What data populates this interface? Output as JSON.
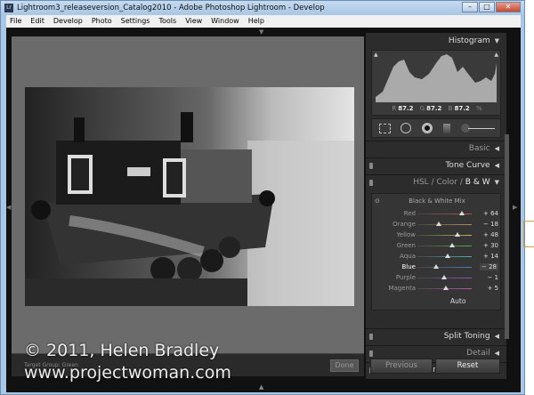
{
  "window": {
    "title": "Lightroom3_releaseversion_Catalog2010 - Adobe Photoshop Lightroom - Develop",
    "app_icon": "Lr",
    "controls": [
      "minimize",
      "maximize",
      "close"
    ]
  },
  "menu": [
    "File",
    "Edit",
    "Develop",
    "Photo",
    "Settings",
    "Tools",
    "View",
    "Window",
    "Help"
  ],
  "toolbar": {
    "target_group": "Target Group: Green",
    "done_label": "Done"
  },
  "watermark": {
    "line1": "© 2011, Helen Bradley",
    "line2": "www.projectwoman.com"
  },
  "panel": {
    "histogram": {
      "title": "Histogram",
      "r_label": "R",
      "r": "87.2",
      "g_label": "G",
      "g": "87.2",
      "b_label": "B",
      "b": "87.2",
      "unit": "%"
    },
    "sections": {
      "basic": "Basic",
      "tone_curve": "Tone Curve",
      "hsl": "HSL",
      "sep": "/",
      "color": "Color",
      "bw": "B & W",
      "split_toning": "Split Toning",
      "detail": "Detail",
      "lens": "Lens Corrections"
    },
    "bw_mix": {
      "title": "Black & White Mix",
      "auto_label": "Auto",
      "rows": [
        {
          "label": "Red",
          "value": "+ 64",
          "n": 64,
          "color": "#b55"
        },
        {
          "label": "Orange",
          "value": "− 18",
          "n": -18,
          "color": "#b85"
        },
        {
          "label": "Yellow",
          "value": "+ 48",
          "n": 48,
          "color": "#bb5"
        },
        {
          "label": "Green",
          "value": "+ 30",
          "n": 30,
          "color": "#5a5"
        },
        {
          "label": "Aqua",
          "value": "+ 14",
          "n": 14,
          "color": "#5aa"
        },
        {
          "label": "Blue",
          "value": "− 28",
          "n": -28,
          "color": "#57b"
        },
        {
          "label": "Purple",
          "value": "− 1",
          "n": -1,
          "color": "#85b"
        },
        {
          "label": "Magenta",
          "value": "+ 5",
          "n": 5,
          "color": "#b5a"
        }
      ]
    },
    "previous_label": "Previous",
    "reset_label": "Reset"
  }
}
